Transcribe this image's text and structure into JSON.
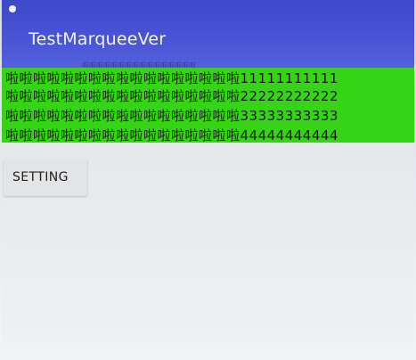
{
  "app_bar": {
    "title": "TestMarqueeVer",
    "color": "#4a55d6"
  },
  "marquee": {
    "background_color": "#35d414",
    "overflow_text": "啦啦啦啦啦啦啦啦啦啦啦啦啦啦啦啦",
    "lines": [
      "啦啦啦啦啦啦啦啦啦啦啦啦啦啦啦啦啦11111111111",
      "啦啦啦啦啦啦啦啦啦啦啦啦啦啦啦啦啦22222222222",
      "啦啦啦啦啦啦啦啦啦啦啦啦啦啦啦啦啦33333333333",
      "啦啦啦啦啦啦啦啦啦啦啦啦啦啦啦啦啦44444444444"
    ]
  },
  "setting_button": {
    "label": "SETTING"
  }
}
